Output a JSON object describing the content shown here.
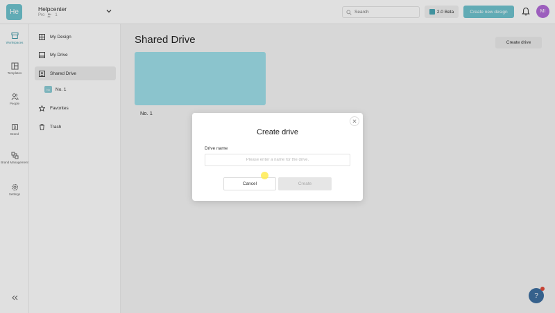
{
  "workspace": {
    "badge": "He",
    "name": "Helpcenter",
    "plan": "Pro",
    "member_count": "1"
  },
  "topbar": {
    "search_placeholder": "Search",
    "beta_label": "2.0 Beta",
    "create_design_label": "Create new design",
    "avatar_initials": "MI"
  },
  "rail": {
    "items": [
      {
        "label": "Workspaces",
        "icon": "workspaces-icon",
        "active": true
      },
      {
        "label": "Templates",
        "icon": "templates-icon",
        "active": false
      },
      {
        "label": "People",
        "icon": "people-icon",
        "active": false
      },
      {
        "label": "Brand",
        "icon": "brand-icon",
        "active": false
      },
      {
        "label": "Brand Management",
        "icon": "brand-management-icon",
        "active": false
      },
      {
        "label": "Settings",
        "icon": "settings-icon",
        "active": false
      }
    ]
  },
  "sidebar": {
    "items": [
      {
        "label": "My Design",
        "icon": "my-design-icon"
      },
      {
        "label": "My Drive",
        "icon": "my-drive-icon"
      },
      {
        "label": "Shared Drive",
        "icon": "shared-drive-icon"
      },
      {
        "label": "Favorites",
        "icon": "star-icon"
      },
      {
        "label": "Trash",
        "icon": "trash-icon"
      }
    ],
    "sub_drive": {
      "badge": "No",
      "label": "No. 1"
    }
  },
  "main": {
    "title": "Shared Drive",
    "create_drive_label": "Create drive",
    "drives": [
      {
        "label": "No. 1",
        "color": "#9fe0ea"
      }
    ]
  },
  "modal": {
    "title": "Create drive",
    "field_label": "Drive name",
    "field_placeholder": "Please enter a name for the drive.",
    "field_value": "",
    "cancel_label": "Cancel",
    "create_label": "Create"
  },
  "help": {
    "label": "?"
  },
  "colors": {
    "accent": "#6fc3cf",
    "avatar": "#b26bd8",
    "help": "#3e6fa0"
  }
}
